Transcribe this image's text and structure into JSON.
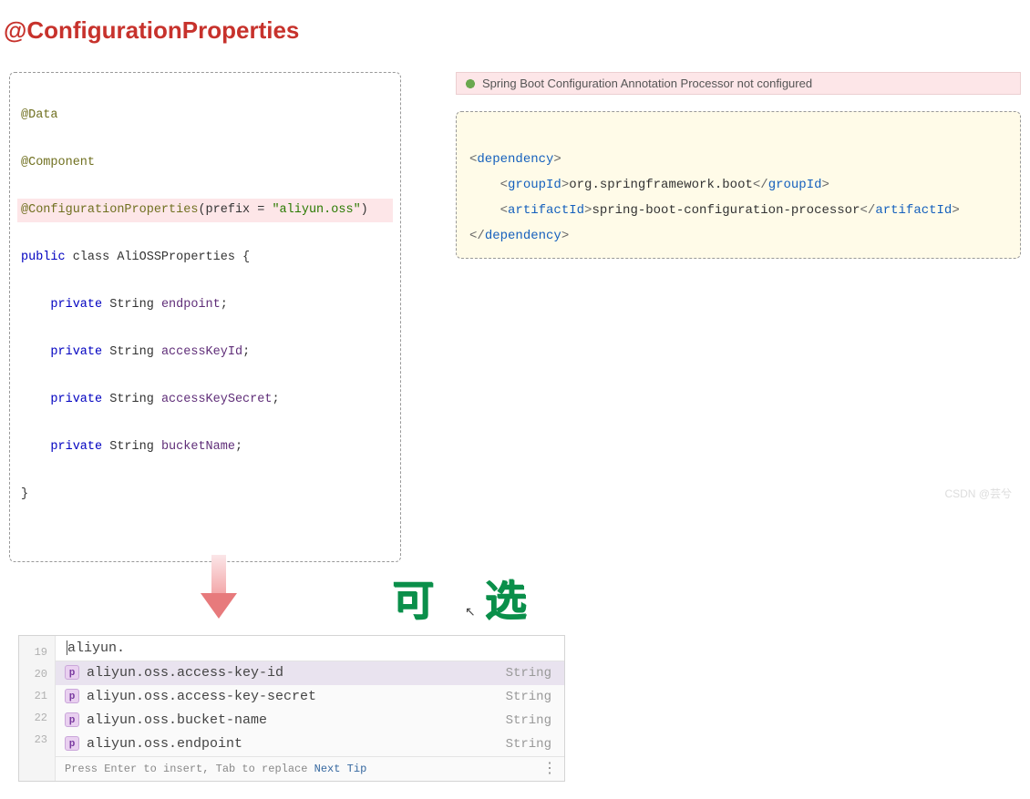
{
  "title": "@ConfigurationProperties",
  "code": {
    "l1": "@Data",
    "l2": "@Component",
    "l3_a": "@ConfigurationProperties",
    "l3_b": "(prefix = ",
    "l3_c": "\"aliyun.oss\"",
    "l3_d": ")",
    "l4_a": "public",
    "l4_b": " class ",
    "l4_c": "AliOSSProperties",
    "l4_d": " {",
    "l5_a": "    private",
    "l5_b": " String ",
    "l5_c": "endpoint",
    "l5_d": ";",
    "l6_a": "    private",
    "l6_b": " String ",
    "l6_c": "accessKeyId",
    "l6_d": ";",
    "l7_a": "    private",
    "l7_b": " String ",
    "l7_c": "accessKeySecret",
    "l7_d": ";",
    "l8_a": "    private",
    "l8_b": " String ",
    "l8_c": "bucketName",
    "l8_d": ";",
    "l9": "}"
  },
  "warning": "Spring Boot Configuration Annotation Processor not configured",
  "xml": {
    "dep_open": "dependency",
    "gid_open": "groupId",
    "gid_val": "org.springframework.boot",
    "aid_open": "artifactId",
    "aid_val": "spring-boot-configuration-processor"
  },
  "handwritten": "可 选",
  "popup": {
    "gutter": [
      "19",
      "20",
      "21",
      "22",
      "23"
    ],
    "typed": "aliyun.",
    "options": [
      {
        "label": "aliyun.oss.access-key-id",
        "type": "String",
        "selected": true
      },
      {
        "label": "aliyun.oss.access-key-secret",
        "type": "String",
        "selected": false
      },
      {
        "label": "aliyun.oss.bucket-name",
        "type": "String",
        "selected": false
      },
      {
        "label": "aliyun.oss.endpoint",
        "type": "String",
        "selected": false
      }
    ],
    "hint_a": "Press Enter to insert, Tab to replace  ",
    "hint_b": "Next Tip"
  },
  "watermark": "CSDN @芸兮"
}
